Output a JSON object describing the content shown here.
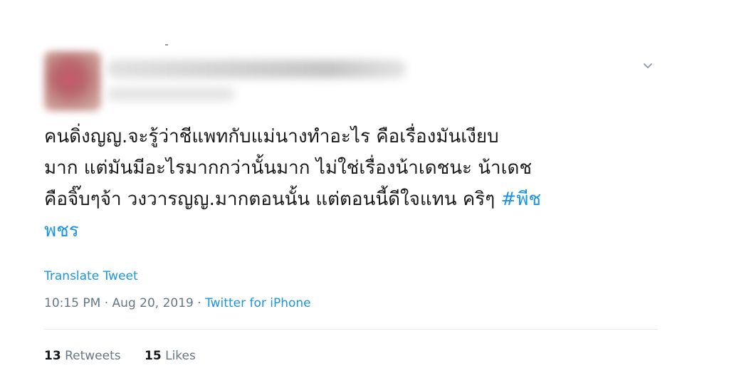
{
  "tweet": {
    "body_lines": [
      "คนดิ่งญญ.จะรู้ว่าชีแพทกับแม่นางทำอะไร คือเรื่องมันเงียบ",
      "มาก แต่มันมีอะไรมากกว่านั้นมาก ไม่ใช่เรื่องน้าเดชนะ น้าเดช",
      "คือจิ๊บๆจ้า วงวารญญ.มากตอนนั้น แต่ตอนนี้ดีใจแทน คริๆ "
    ],
    "hashtag_part1": "#พีช",
    "hashtag_part2": "พชร",
    "translate_label": "Translate Tweet",
    "time": "10:15 PM",
    "separator1": " · ",
    "date": "Aug 20, 2019",
    "separator2": " · ",
    "source": "Twitter for iPhone",
    "retweets_count": "13",
    "retweets_label": "Retweets",
    "likes_count": "15",
    "likes_label": "Likes"
  },
  "icons": {
    "caret": "chevron-down-icon"
  },
  "colors": {
    "link": "#1b95e0",
    "muted": "#657786",
    "text": "#14171a"
  }
}
